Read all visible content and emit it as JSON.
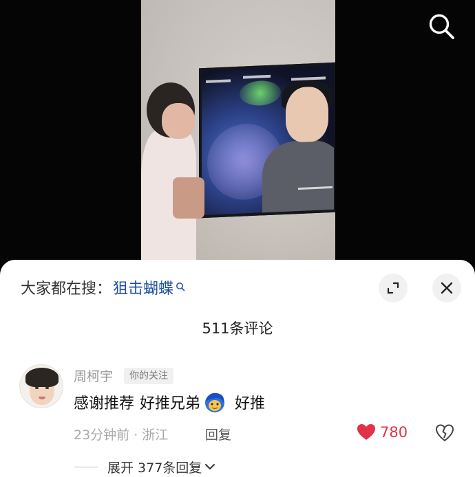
{
  "video": {
    "search_icon": "search-icon"
  },
  "panel": {
    "trending": {
      "prefix": "大家都在搜：",
      "term": "狙击蝴蝶",
      "icon": "mini-search-icon"
    },
    "expand_icon": "expand-icon",
    "close_icon": "close-icon",
    "comment_count": "511条评论"
  },
  "comment": {
    "author": "周柯宇",
    "badge": "你的关注",
    "text_part1": "感谢推荐",
    "text_part2": "好推兄弟",
    "emoji": "blue-hair-emoji",
    "text_part3": "好推",
    "meta": "23分钟前 · 浙江",
    "reply_label": "回复",
    "likes": "780",
    "like_color": "#e0334a",
    "dislike_icon": "dislike-heart-icon"
  },
  "expand_replies": {
    "label": "展开 377条回复",
    "icon": "chevron-down-icon"
  }
}
